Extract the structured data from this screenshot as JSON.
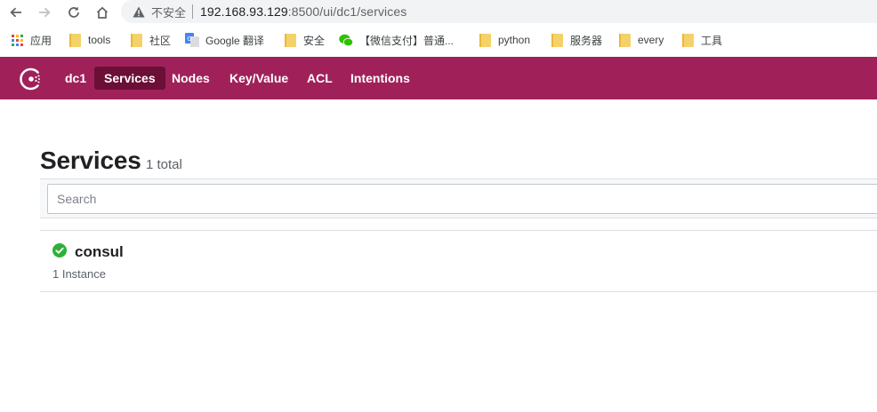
{
  "browser": {
    "security_label": "不安全",
    "url_host": "192.168.93.129",
    "url_path": ":8500/ui/dc1/services",
    "bookmarks": [
      {
        "label": "应用",
        "icon": "apps-grid-icon"
      },
      {
        "label": "tools",
        "icon": "folder-icon"
      },
      {
        "label": "社区",
        "icon": "folder-icon"
      },
      {
        "label": "Google 翻译",
        "icon": "google-translate-icon"
      },
      {
        "label": "安全",
        "icon": "folder-icon"
      },
      {
        "label": "【微信支付】普通...",
        "icon": "wechat-icon"
      },
      {
        "label": "python",
        "icon": "folder-icon"
      },
      {
        "label": "服务器",
        "icon": "folder-icon"
      },
      {
        "label": "every",
        "icon": "folder-icon"
      },
      {
        "label": "工具",
        "icon": "folder-icon"
      }
    ]
  },
  "nav": {
    "items": [
      {
        "label": "dc1"
      },
      {
        "label": "Services",
        "active": true
      },
      {
        "label": "Nodes"
      },
      {
        "label": "Key/Value"
      },
      {
        "label": "ACL"
      },
      {
        "label": "Intentions"
      }
    ],
    "colors": {
      "nav_bg": "#a0215a",
      "active_bg": "#6b0f37"
    }
  },
  "main": {
    "title": "Services",
    "count": "1 total",
    "search_placeholder": "Search",
    "services": [
      {
        "name": "consul",
        "instances": "1 Instance",
        "health": "passing",
        "health_color": "#2eb039"
      }
    ]
  }
}
